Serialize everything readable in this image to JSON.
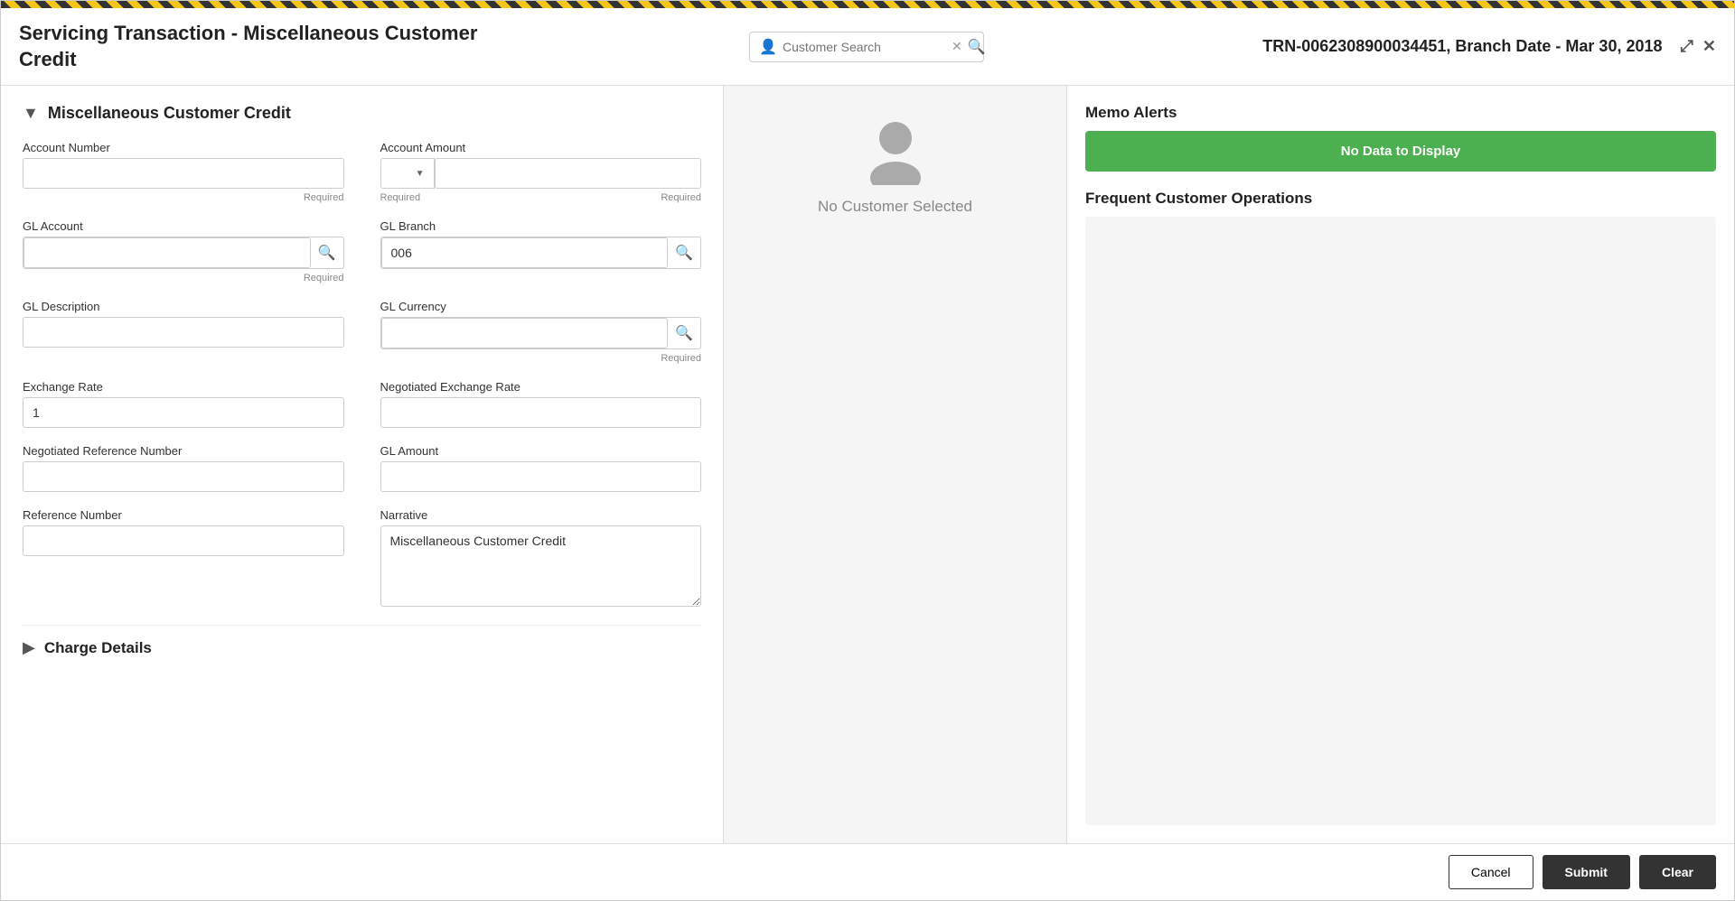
{
  "header": {
    "title": "Servicing Transaction - Miscellaneous Customer Credit",
    "search_placeholder": "Customer Search",
    "trn_info": "TRN-0062308900034451, Branch Date - Mar 30, 2018",
    "maximize_icon": "⤢",
    "close_icon": "✕"
  },
  "section_misc": {
    "collapse_icon": "▼",
    "title": "Miscellaneous Customer Credit",
    "fields": {
      "account_number": {
        "label": "Account Number",
        "value": "",
        "placeholder": "",
        "required": "Required"
      },
      "account_amount": {
        "label": "Account Amount",
        "currency_value": "",
        "amount_value": "",
        "required_currency": "Required",
        "required_amount": "Required"
      },
      "gl_account": {
        "label": "GL Account",
        "value": "",
        "required": "Required"
      },
      "gl_branch": {
        "label": "GL Branch",
        "value": "006"
      },
      "gl_description": {
        "label": "GL Description",
        "value": ""
      },
      "gl_currency": {
        "label": "GL Currency",
        "value": "",
        "required": "Required"
      },
      "exchange_rate": {
        "label": "Exchange Rate",
        "value": "1"
      },
      "negotiated_exchange_rate": {
        "label": "Negotiated Exchange Rate",
        "value": ""
      },
      "negotiated_reference_number": {
        "label": "Negotiated Reference Number",
        "value": ""
      },
      "gl_amount": {
        "label": "GL Amount",
        "value": ""
      },
      "reference_number": {
        "label": "Reference Number",
        "value": ""
      },
      "narrative": {
        "label": "Narrative",
        "value": "Miscellaneous Customer Credit"
      }
    }
  },
  "charge_details": {
    "expand_icon": "▶",
    "title": "Charge Details"
  },
  "customer_panel": {
    "no_customer_text": "No Customer Selected"
  },
  "memo_alerts": {
    "title": "Memo Alerts",
    "no_data_label": "No Data to Display"
  },
  "frequent_customer": {
    "title": "Frequent Customer Operations"
  },
  "footer": {
    "cancel_label": "Cancel",
    "submit_label": "Submit",
    "clear_label": "Clear"
  }
}
